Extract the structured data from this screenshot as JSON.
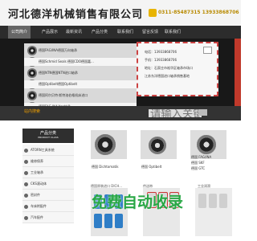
{
  "header": {
    "company": "河北德洋机械销售有限公司",
    "phone": "0311-85487315  13933868706"
  },
  "nav": {
    "items": [
      "公司简介",
      "产品展示",
      "最新资讯",
      "产品分类",
      "联系我们",
      "留言反馈",
      "联系我们"
    ]
  },
  "hero": {
    "items": [
      "德国FAG/INA德国万向轴承",
      "德国Schmid Seals 德国CDO德国嘉...",
      "德国NTN德国NTN进口轴承",
      "德国Optibelt德国Optibelt",
      "德国阿尔贝特·斯特洛伯格机床进口",
      "德国FAG INA进口轴承"
    ]
  },
  "contact": {
    "lines": [
      "电话：13933868706",
      "手机：13933868706",
      "地址：石家庄市裕华区轴承市场口",
      "江苏东洋德国进口轴承销售基地"
    ]
  },
  "search": {
    "label": "站内搜索",
    "placeholder": "请输入关键字"
  },
  "sidebar": {
    "title_cn": "产品分类",
    "title_en": "PRODUCT CLASS",
    "items": [
      "ATORN工具系统",
      "维修保养",
      "工业轴承",
      "CKS滚动体",
      "密封件",
      "车床附配件",
      "汽车配件"
    ]
  },
  "products": {
    "items": [
      "德国 Dichtomatik",
      "德国 Optibelt",
      "德国 FAG/INA",
      "德国 SKF",
      "德国 GTC"
    ],
    "bottom_labels": [
      "德国原装进口 DICH...",
      "传送带",
      "工业润滑"
    ]
  },
  "watermark": "免费自动收录",
  "colors": {
    "accent": "#c0392b",
    "brand": "#2c2c2c",
    "highlight": "#f0a000"
  }
}
